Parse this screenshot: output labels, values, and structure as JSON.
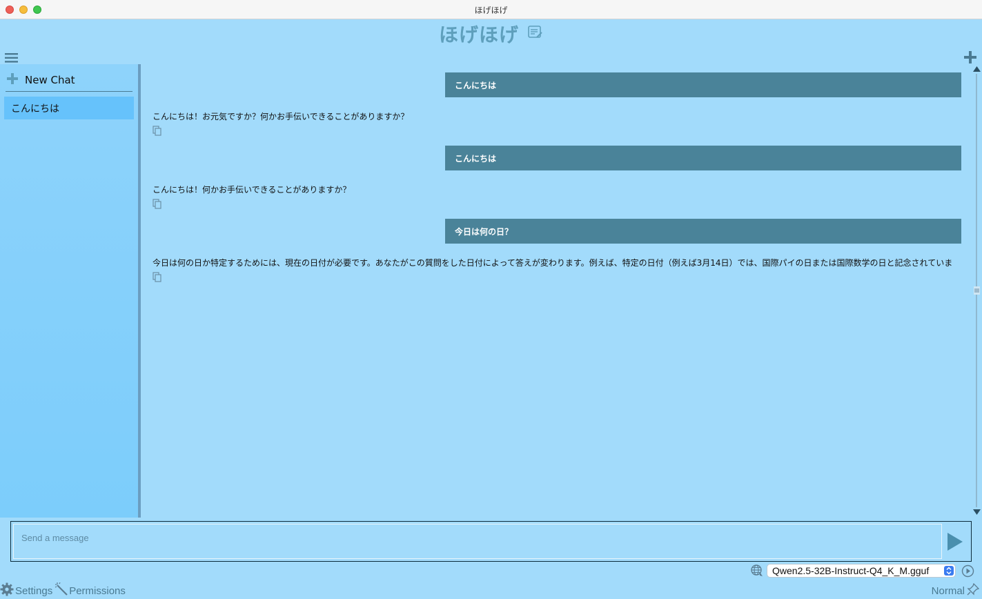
{
  "window": {
    "title": "ほげほげ"
  },
  "header": {
    "title": "ほげほげ"
  },
  "sidebar": {
    "new_chat_label": "New Chat",
    "items": [
      {
        "label": "こんにちは"
      }
    ]
  },
  "messages": [
    {
      "role": "user",
      "text": "こんにちは"
    },
    {
      "role": "assistant",
      "text": "こんにちは！お元気ですか？何かお手伝いできることがありますか？"
    },
    {
      "role": "user",
      "text": "こんにちは"
    },
    {
      "role": "assistant",
      "text": "こんにちは！何かお手伝いできることがありますか？"
    },
    {
      "role": "user",
      "text": "今日は何の日？"
    },
    {
      "role": "assistant",
      "text": "今日は何の日か特定するためには、現在の日付が必要です。あなたがこの質問をした日付によって答えが変わります。例えば、特定の日付（例えば3月14日）では、国際パイの日または国際数学の日と記念されていま"
    }
  ],
  "composer": {
    "placeholder": "Send a message"
  },
  "model": {
    "selected": "Qwen2.5-32B-Instruct-Q4_K_M.gguf"
  },
  "footer": {
    "settings_label": "Settings",
    "permissions_label": "Permissions",
    "mode_label": "Normal"
  },
  "colors": {
    "background": "#a2dbfb",
    "sidebar_selected": "#66c2fb",
    "user_bubble": "#4a8399",
    "accent": "#5e9fbc"
  },
  "icons": [
    "hamburger-menu-icon",
    "edit-note-icon",
    "plus-icon",
    "copy-icon",
    "send-icon",
    "globe-icon",
    "play-circle-icon",
    "gear-icon",
    "magic-wand-icon",
    "pin-icon"
  ]
}
